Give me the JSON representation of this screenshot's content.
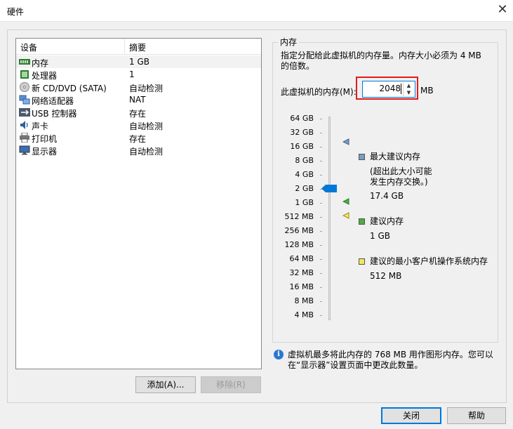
{
  "window": {
    "title": "硬件"
  },
  "device_list": {
    "columns": [
      "设备",
      "摘要"
    ],
    "items": [
      {
        "name": "内存",
        "summary": "1 GB",
        "icon": "memory-icon",
        "selected": true
      },
      {
        "name": "处理器",
        "summary": "1",
        "icon": "processor-icon"
      },
      {
        "name": "新 CD/DVD (SATA)",
        "summary": "自动检测",
        "icon": "cd-dvd-icon"
      },
      {
        "name": "网络适配器",
        "summary": "NAT",
        "icon": "network-adapter-icon"
      },
      {
        "name": "USB 控制器",
        "summary": "存在",
        "icon": "usb-icon"
      },
      {
        "name": "声卡",
        "summary": "自动检测",
        "icon": "sound-card-icon"
      },
      {
        "name": "打印机",
        "summary": "存在",
        "icon": "printer-icon"
      },
      {
        "name": "显示器",
        "summary": "自动检测",
        "icon": "display-icon"
      }
    ]
  },
  "buttons": {
    "add": "添加(A)...",
    "remove": "移除(R)",
    "close": "关闭",
    "help": "帮助"
  },
  "memory": {
    "group_title": "内存",
    "description": "指定分配给此虚拟机的内存量。内存大小必须为 4 MB 的倍数。",
    "field_label": "此虚拟机的内存(M):",
    "value": "2048",
    "unit": "MB",
    "scale": [
      "64 GB",
      "32 GB",
      "16 GB",
      "8 GB",
      "4 GB",
      "2 GB",
      "1 GB",
      "512 MB",
      "256 MB",
      "128 MB",
      "64 MB",
      "32 MB",
      "16 MB",
      "8 MB",
      "4 MB"
    ],
    "slider_value": "2 GB",
    "legend": {
      "max": {
        "title": "最大建议内存",
        "note": "(超出此大小可能发生内存交换。)",
        "value": "17.4 GB"
      },
      "recommended": {
        "title": "建议内存",
        "value": "1 GB"
      },
      "minimum": {
        "title": "建议的最小客户机操作系统内存",
        "value": "512 MB"
      }
    },
    "info": "虚拟机最多将此内存的 768 MB 用作图形内存。您可以在“显示器”设置页面中更改此数量。"
  },
  "colors": {
    "accent": "#0078d7",
    "highlight": "#e01c1c",
    "max_marker": "#7a9cc6",
    "recommended_marker": "#4caf3a",
    "minimum_marker": "#f2e85c"
  }
}
